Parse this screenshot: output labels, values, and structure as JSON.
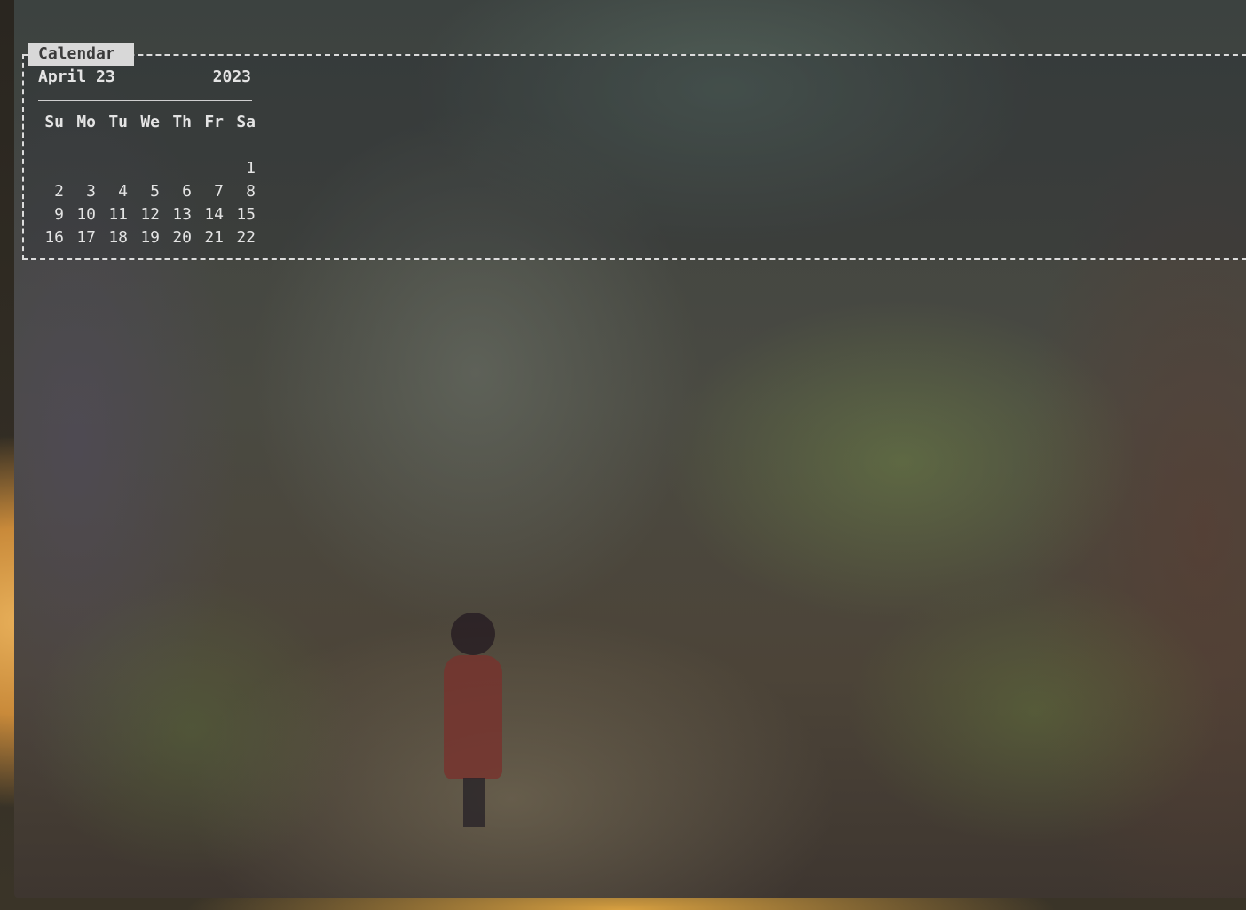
{
  "widget": {
    "title": "Calendar",
    "month_day": "April 23",
    "year": "2023",
    "weekdays": [
      "Su",
      "Mo",
      "Tu",
      "We",
      "Th",
      "Fr",
      "Sa"
    ],
    "weeks": [
      [
        "",
        "",
        "",
        "",
        "",
        "",
        "1"
      ],
      [
        "2",
        "3",
        "4",
        "5",
        "6",
        "7",
        "8"
      ],
      [
        "9",
        "10",
        "11",
        "12",
        "13",
        "14",
        "15"
      ],
      [
        "16",
        "17",
        "18",
        "19",
        "20",
        "21",
        "22"
      ]
    ]
  },
  "colors": {
    "text": "#e4e4e4",
    "tab_background": "#d8d8d8",
    "border": "#dcdcdc"
  }
}
